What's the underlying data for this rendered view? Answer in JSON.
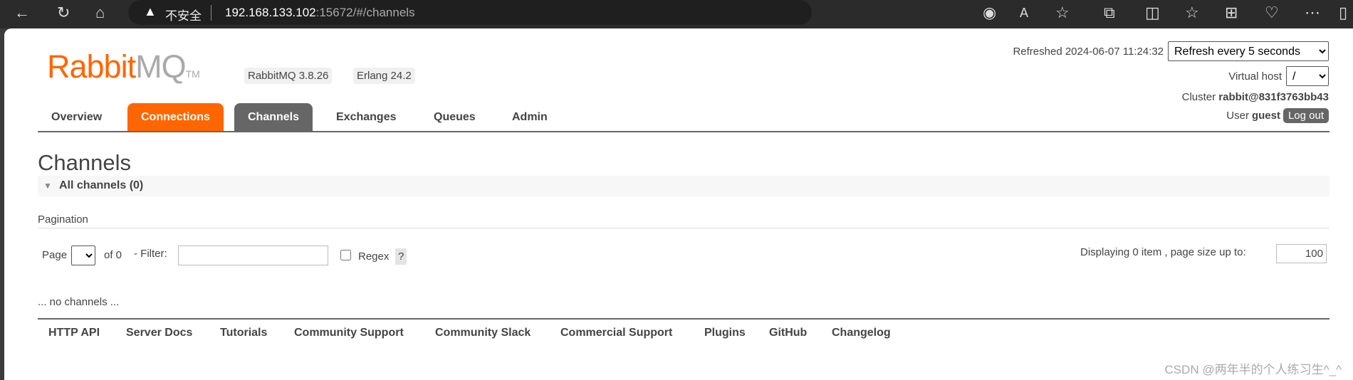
{
  "browser": {
    "insecure_label": "不安全",
    "url_host": "192.168.133.102",
    "url_rest": ":15672/#/channels",
    "icons": [
      "back-icon",
      "reload-icon",
      "home-icon",
      "warning-icon",
      "edge-icon",
      "read-aloud-icon",
      "favorite-star-icon",
      "extensions-icon",
      "split-screen-icon",
      "favorites-icon",
      "collections-icon",
      "health-icon",
      "more-icon",
      "sidebar-icon"
    ]
  },
  "brand": {
    "logo_rabbit": "Rabbit",
    "logo_mq": "MQ",
    "logo_tm": "TM",
    "version": "RabbitMQ 3.8.26",
    "erlang": "Erlang 24.2",
    "accent": "#ff6600"
  },
  "nav": {
    "tabs": [
      {
        "label": "Overview"
      },
      {
        "label": "Connections"
      },
      {
        "label": "Channels"
      },
      {
        "label": "Exchanges"
      },
      {
        "label": "Queues"
      },
      {
        "label": "Admin"
      }
    ]
  },
  "status": {
    "refreshed_label": "Refreshed 2024-06-07 11:24:32",
    "refresh_option": "Refresh every 5 seconds",
    "vhost_label": "Virtual host",
    "vhost_value": "/",
    "cluster_label": "Cluster",
    "cluster_value": "rabbit@831f3763bb43",
    "user_label": "User",
    "user_value": "guest",
    "logout": "Log out"
  },
  "main": {
    "title": "Channels",
    "section": "All channels (0)",
    "pagination_label": "Pagination",
    "page_label": "Page",
    "of_label": "of 0",
    "filter_label": "- Filter:",
    "filter_value": "",
    "regex_label": "Regex",
    "help": "?",
    "displaying": "Displaying 0 item , page size up to:",
    "page_size": "100",
    "empty": "... no channels ..."
  },
  "footer": {
    "links": [
      "HTTP API",
      "Server Docs",
      "Tutorials",
      "Community Support",
      "Community Slack",
      "Commercial Support",
      "Plugins",
      "GitHub",
      "Changelog"
    ]
  },
  "watermark": "CSDN @两年半的个人练习生^_^"
}
